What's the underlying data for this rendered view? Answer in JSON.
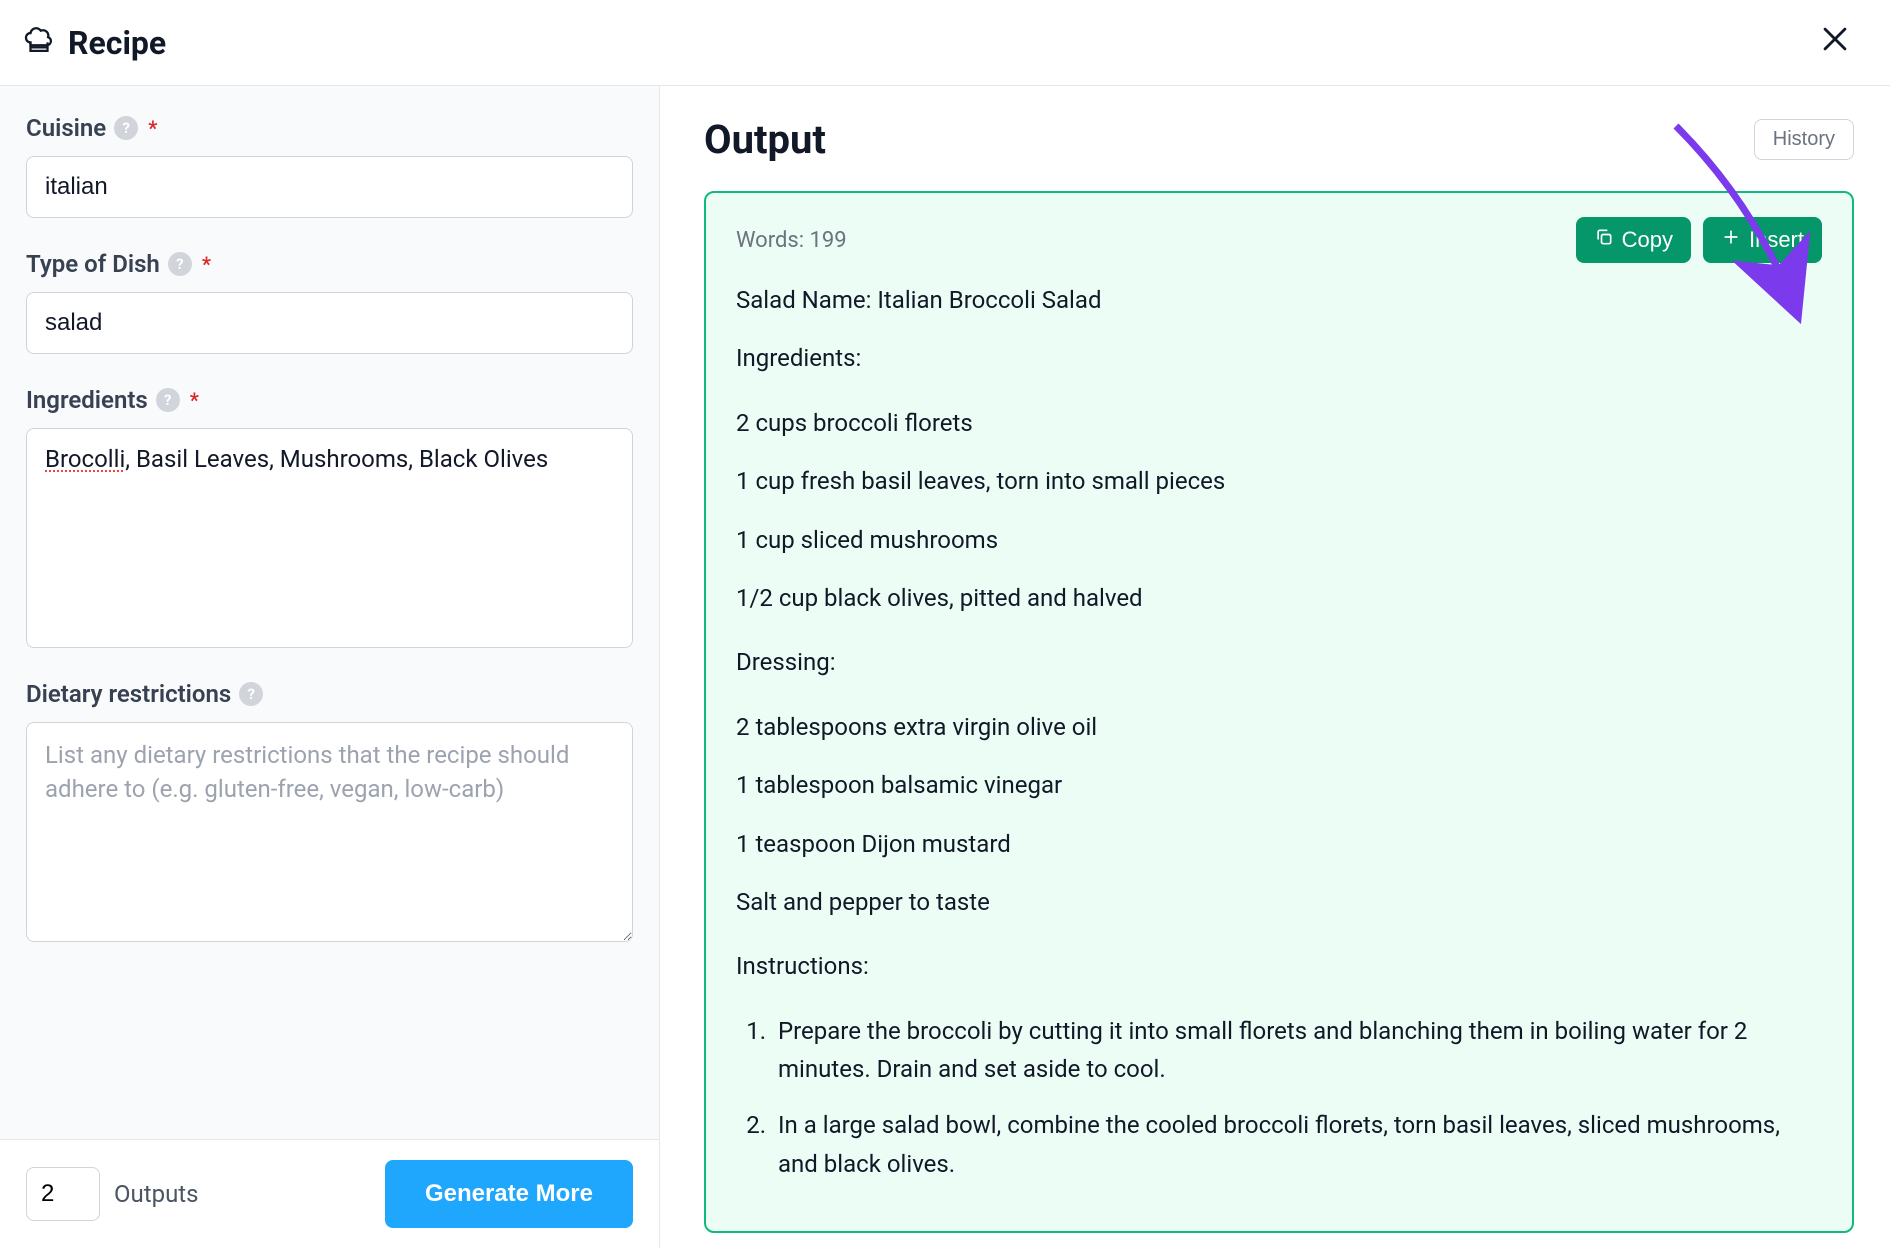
{
  "header": {
    "title": "Recipe"
  },
  "form": {
    "cuisine": {
      "label": "Cuisine",
      "value": "italian",
      "required": true
    },
    "dish_type": {
      "label": "Type of Dish",
      "value": "salad",
      "required": true
    },
    "ingredients": {
      "label": "Ingredients",
      "value_misspelled_word": "Brocolli",
      "value_rest": ", Basil Leaves, Mushrooms, Black Olives",
      "required": true
    },
    "dietary": {
      "label": "Dietary restrictions",
      "placeholder": "List any dietary restrictions that the recipe should adhere to (e.g. gluten-free, vegan, low-carb)",
      "value": "",
      "required": false
    }
  },
  "footer": {
    "outputs_count": "2",
    "outputs_label": "Outputs",
    "generate_label": "Generate More"
  },
  "output": {
    "title": "Output",
    "history_label": "History",
    "word_count_label": "Words: 199",
    "copy_label": "Copy",
    "insert_label": "Insert",
    "recipe": {
      "name_line": "Salad Name: Italian Broccoli Salad",
      "ingredients_header": "Ingredients:",
      "ingredients": [
        "2 cups broccoli florets",
        "1 cup fresh basil leaves, torn into small pieces",
        "1 cup sliced mushrooms",
        "1/2 cup black olives, pitted and halved"
      ],
      "dressing_header": "Dressing:",
      "dressing": [
        "2 tablespoons extra virgin olive oil",
        "1 tablespoon balsamic vinegar",
        "1 teaspoon Dijon mustard",
        "Salt and pepper to taste"
      ],
      "instructions_header": "Instructions:",
      "instructions": [
        "Prepare the broccoli by cutting it into small florets and blanching them in boiling water for 2 minutes. Drain and set aside to cool.",
        "In a large salad bowl, combine the cooled broccoli florets, torn basil leaves, sliced mushrooms, and black olives."
      ]
    }
  },
  "colors": {
    "accent_green": "#059669",
    "accent_blue": "#1ea7fd",
    "annotation_purple": "#7c3aed"
  }
}
